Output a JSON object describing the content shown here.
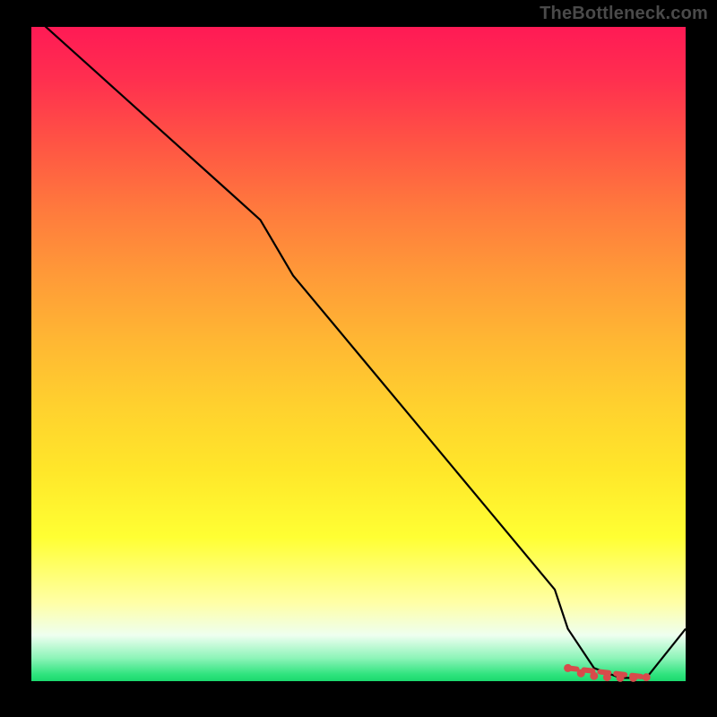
{
  "watermark": "TheBottleneck.com",
  "chart_data": {
    "type": "line",
    "title": "",
    "xlabel": "",
    "ylabel": "",
    "xlim": [
      0,
      100
    ],
    "ylim": [
      0,
      100
    ],
    "grid": false,
    "legend": false,
    "background_gradient": {
      "top": "#ff1a55",
      "mid": "#ffe72a",
      "bottom": "#1bd96e"
    },
    "series": [
      {
        "name": "curve",
        "x": [
          0,
          10,
          20,
          30,
          35,
          40,
          50,
          60,
          70,
          80,
          82,
          86,
          90,
          94,
          100
        ],
        "y": [
          102,
          93,
          84,
          75,
          70.5,
          62,
          50,
          38,
          26,
          14,
          8,
          2,
          0.5,
          0.5,
          8
        ]
      }
    ],
    "markers": {
      "comment": "red dotted segment near minimum",
      "x": [
        82,
        84,
        86,
        88,
        90,
        92,
        94
      ],
      "y": [
        2,
        1.2,
        0.8,
        0.6,
        0.5,
        0.5,
        0.6
      ]
    }
  }
}
